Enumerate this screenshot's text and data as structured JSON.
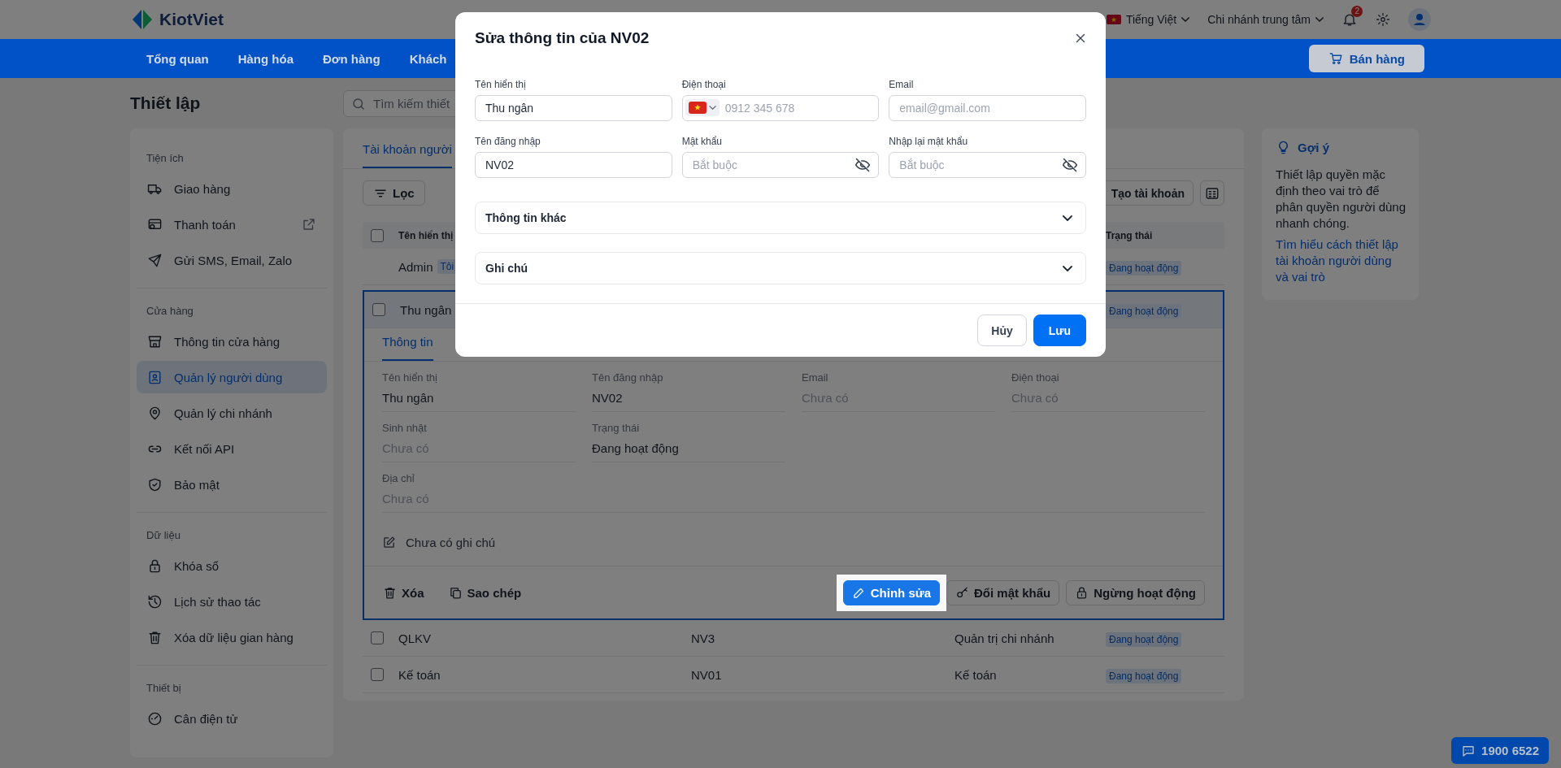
{
  "header": {
    "logo": "KiotViet",
    "language": "Tiếng Việt",
    "branch": "Chi nhánh trung tâm",
    "notification_count": "2"
  },
  "nav": {
    "items": [
      {
        "label": "Tổng quan"
      },
      {
        "label": "Hàng hóa"
      },
      {
        "label": "Đơn hàng"
      },
      {
        "label": "Khách"
      }
    ],
    "sell_button": "Bán hàng"
  },
  "page_title": "Thiết lập",
  "search": {
    "placeholder": "Tìm kiếm thiết"
  },
  "sidebar": {
    "groups": [
      {
        "title": "Tiện ích",
        "items": [
          {
            "label": "Giao hàng",
            "selected": false,
            "external": false
          },
          {
            "label": "Thanh toán",
            "selected": false,
            "external": true
          },
          {
            "label": "Gửi SMS, Email, Zalo",
            "selected": false,
            "external": false
          }
        ]
      },
      {
        "title": "Cửa hàng",
        "items": [
          {
            "label": "Thông tin cửa hàng",
            "selected": false,
            "external": false
          },
          {
            "label": "Quản lý người dùng",
            "selected": true,
            "external": false
          },
          {
            "label": "Quản lý chi nhánh",
            "selected": false,
            "external": false
          },
          {
            "label": "Kết nối API",
            "selected": false,
            "external": false
          },
          {
            "label": "Bảo mật",
            "selected": false,
            "external": false
          }
        ]
      },
      {
        "title": "Dữ liệu",
        "items": [
          {
            "label": "Khóa sổ",
            "selected": false,
            "external": false
          },
          {
            "label": "Lịch sử thao tác",
            "selected": false,
            "external": false
          },
          {
            "label": "Xóa dữ liệu gian hàng",
            "selected": false,
            "external": false
          }
        ]
      },
      {
        "title": "Thiết bị",
        "items": [
          {
            "label": "Cân điện tử",
            "selected": false,
            "external": false
          }
        ]
      }
    ]
  },
  "tabs": [
    {
      "label": "Tài khoản người",
      "selected": true
    }
  ],
  "toolbar": {
    "filter": "Lọc",
    "create": "Tạo tài khoản"
  },
  "table": {
    "header_checked": false,
    "columns": {
      "name": "Tên hiển thị",
      "status": "Trạng thái"
    },
    "rows": [
      {
        "name": "Admin",
        "tag": "Tôi",
        "status": "Đang hoạt động",
        "expanded": false
      },
      {
        "name": "Thu ngân",
        "status": "Đang hoạt động",
        "checked": false,
        "expanded": true,
        "detail": {
          "tab": {
            "label": "Thông tin",
            "selected": true
          },
          "field_rows": [
            [
              {
                "label": "Tên hiển thị",
                "value": "Thu ngân",
                "empty": false
              },
              {
                "label": "Tên đăng nhập",
                "value": "NV02",
                "empty": false
              },
              {
                "label": "Email",
                "value": "Chưa có",
                "empty": true
              },
              {
                "label": "Điện thoại",
                "value": "Chưa có",
                "empty": true
              }
            ],
            [
              {
                "label": "Sinh nhật",
                "value": "Chưa có",
                "empty": true
              },
              {
                "label": "Trạng thái",
                "value": "Đang hoạt động",
                "empty": false
              }
            ],
            [
              {
                "label": "Địa chỉ",
                "value": "Chưa có",
                "empty": true
              }
            ]
          ],
          "note": "Chưa có ghi chú",
          "actions": [
            {
              "label": "Xóa",
              "kind": "delete",
              "highlighted": false
            },
            {
              "label": "Sao chép",
              "kind": "copy",
              "highlighted": false
            },
            {
              "label": "Chỉnh sửa",
              "kind": "edit",
              "highlighted": true
            },
            {
              "label": "Đổi mật khẩu",
              "kind": "password",
              "highlighted": false
            },
            {
              "label": "Ngừng hoạt động",
              "kind": "deactivate",
              "highlighted": false
            }
          ]
        }
      },
      {
        "name": "QLKV",
        "username": "NV3",
        "role": "Quản trị chi nhánh",
        "status": "Đang hoạt động",
        "checked": false,
        "expanded": false
      },
      {
        "name": "Kế toán",
        "username": "NV01",
        "role": "Kế toán",
        "status": "Đang hoạt động",
        "checked": false,
        "expanded": false
      }
    ]
  },
  "hint": {
    "title": "Gợi ý",
    "text": "Thiết lập quyền mặc định theo vai trò để phân quyền người dùng nhanh chóng.",
    "link": "Tìm hiểu cách thiết lập tài khoản người dùng và vai trò"
  },
  "support": {
    "phone": "1900 6522"
  },
  "modal": {
    "title": "Sửa thông tin của NV02",
    "fields": [
      {
        "label": "Tên hiển thị",
        "value": "Thu ngân",
        "kind": "text"
      },
      {
        "label": "Điện thoại",
        "placeholder": "0912 345 678",
        "kind": "phone"
      },
      {
        "label": "Email",
        "placeholder": "email@gmail.com",
        "kind": "text"
      },
      {
        "label": "Tên đăng nhập",
        "value": "NV02",
        "kind": "text"
      },
      {
        "label": "Mật khẩu",
        "placeholder": "Bắt buộc",
        "kind": "password"
      },
      {
        "label": "Nhập lại mật khẩu",
        "placeholder": "Bắt buộc",
        "kind": "password"
      }
    ],
    "sections": [
      {
        "title": "Thông tin khác",
        "expanded": false
      },
      {
        "title": "Ghi chú",
        "expanded": false
      }
    ],
    "buttons": [
      {
        "label": "Hủy",
        "kind": "secondary"
      },
      {
        "label": "Lưu",
        "kind": "primary"
      }
    ]
  }
}
